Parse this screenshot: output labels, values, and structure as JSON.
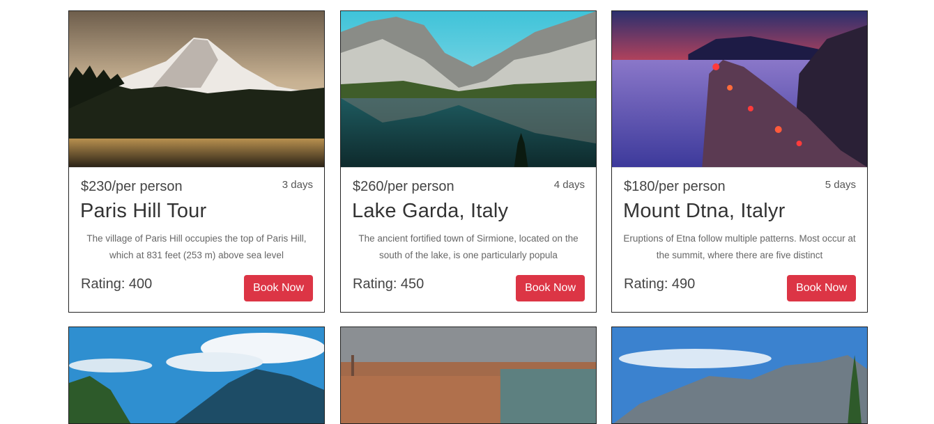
{
  "tours": [
    {
      "image": "mountain-lake-photo",
      "price": "$230/per person",
      "days": "3 days",
      "title": "Paris Hill Tour",
      "description": "The village of Paris Hill occupies the top of Paris Hill, which at 831 feet (253 m) above sea level",
      "rating": "Rating: 400",
      "button": "Book Now"
    },
    {
      "image": "alpine-lake-reflection-photo",
      "price": "$260/per person",
      "days": "4 days",
      "title": "Lake Garda, Italy",
      "description": "The ancient fortified town of Sirmione, located on the south of the lake, is one particularly popula",
      "rating": "Rating: 450",
      "button": "Book Now"
    },
    {
      "image": "coastal-village-sunset-photo",
      "price": "$180/per person",
      "days": "5 days",
      "title": "Mount Dtna, Italyr",
      "description": "Eruptions of Etna follow multiple patterns. Most occur at the summit, where there are five distinct",
      "rating": "Rating: 490",
      "button": "Book Now"
    }
  ],
  "next_row_images": [
    "lake-mountains-sky-photo",
    "city-aerial-photo",
    "mountain-range-photo"
  ],
  "colors": {
    "accent": "#dc3545"
  }
}
